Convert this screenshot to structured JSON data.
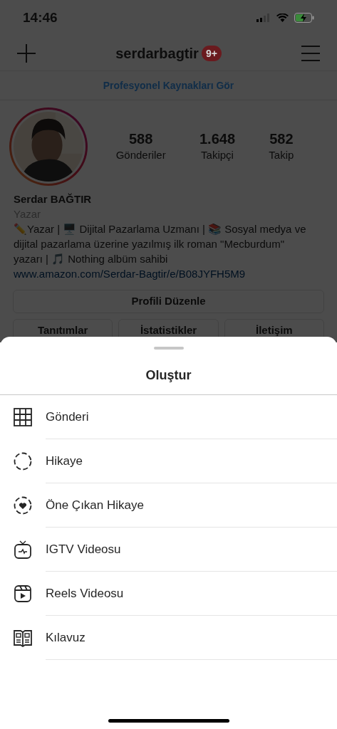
{
  "status_bar": {
    "time": "14:46"
  },
  "header": {
    "username": "serdarbagtir",
    "badge": "9+"
  },
  "pro_link": "Profesyonel Kaynakları Gör",
  "profile": {
    "stats": [
      {
        "value": "588",
        "label": "Gönderiler"
      },
      {
        "value": "1.648",
        "label": "Takipçi"
      },
      {
        "value": "582",
        "label": "Takip"
      }
    ],
    "name": "Serdar BAĞTIR",
    "category": "Yazar",
    "bio": "✏️Yazar | 🖥️ Dijital Pazarlama Uzmanı | 📚 Sosyal medya ve dijital pazarlama üzerine yazılmış ilk roman \"Mecburdum\" yazarı | 🎵 Nothing albüm sahibi",
    "link": "www.amazon.com/Serdar-Bagtir/e/B08JYFH5M9",
    "edit_button": "Profili Düzenle",
    "buttons": [
      "Tanıtımlar",
      "İstatistikler",
      "İletişim"
    ]
  },
  "sheet": {
    "title": "Oluştur",
    "items": [
      {
        "kind": "post",
        "label": "Gönderi"
      },
      {
        "kind": "story",
        "label": "Hikaye"
      },
      {
        "kind": "highlight",
        "label": "Öne Çıkan Hikaye"
      },
      {
        "kind": "igtv",
        "label": "IGTV Videosu"
      },
      {
        "kind": "reels",
        "label": "Reels Videosu"
      },
      {
        "kind": "guide",
        "label": "Kılavuz"
      }
    ]
  }
}
